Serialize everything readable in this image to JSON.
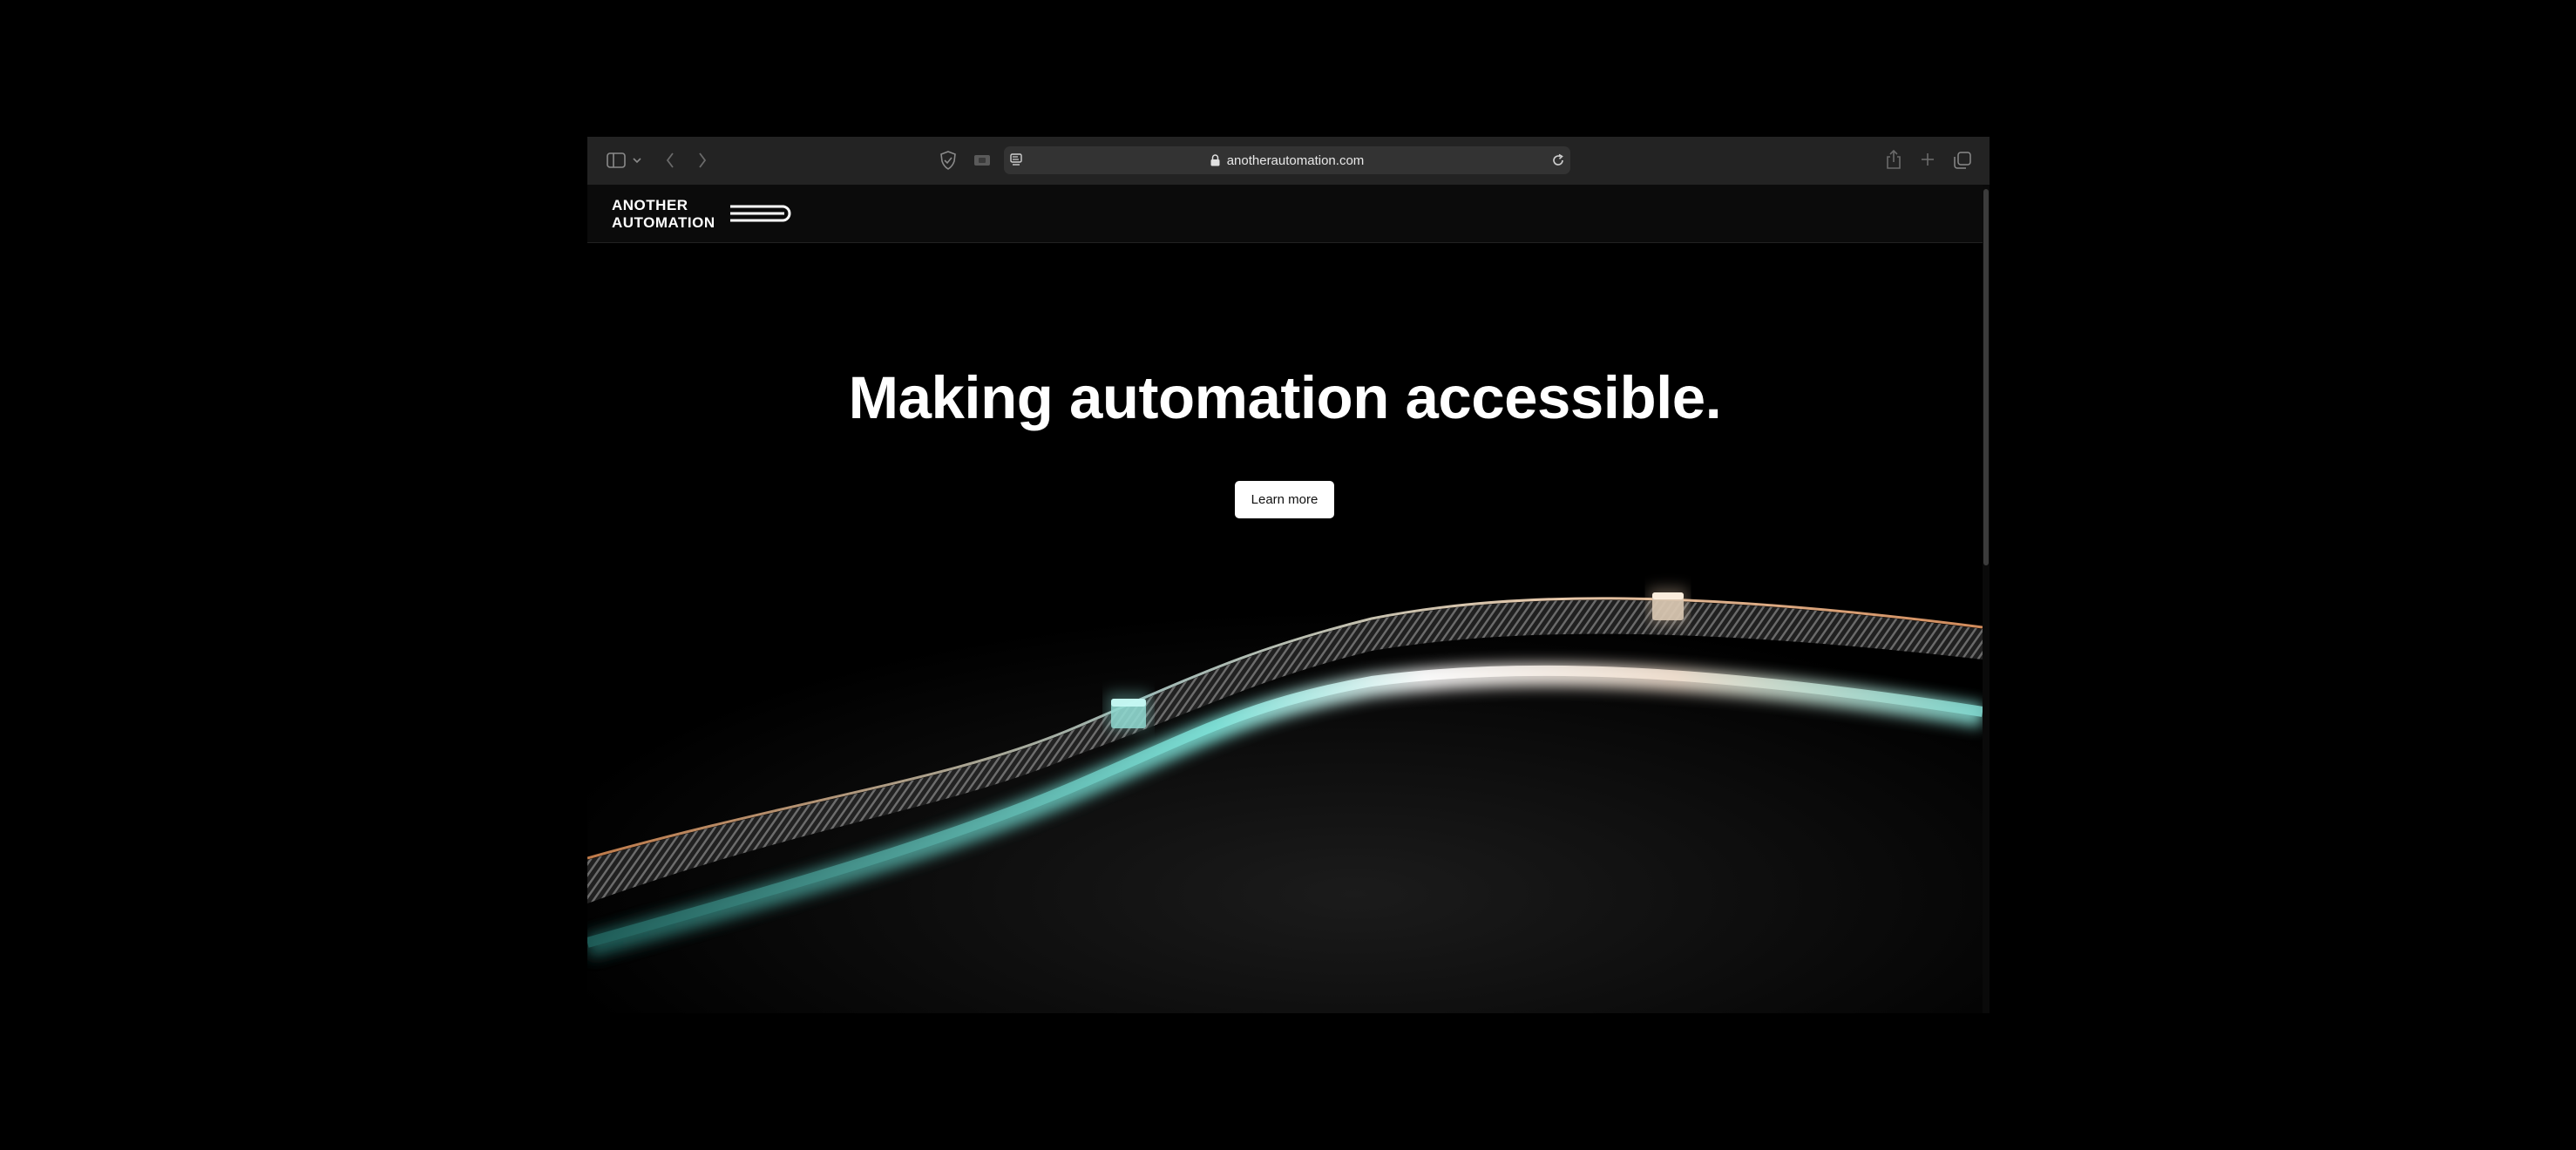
{
  "browser": {
    "url": "anotherautomation.com",
    "icons": [
      "sidebar-toggle-icon",
      "chevron-down-icon",
      "back-icon",
      "forward-icon",
      "privacy-shield-icon",
      "extension-icon",
      "reader-mode-icon",
      "lock-icon",
      "reload-icon",
      "share-icon",
      "new-tab-icon",
      "tab-overview-icon"
    ]
  },
  "site": {
    "logo_text_top": "ANOTHER",
    "logo_text_bottom": "AUTOMATION",
    "hero": {
      "title": "Making automation accessible.",
      "cta_label": "Learn more"
    }
  },
  "colors": {
    "page_background": "#000000",
    "toolbar": "#232323",
    "addressbar": "#333333",
    "conveyor_teal": "#5fd6cf",
    "conveyor_copper": "#d08a5a",
    "conveyor_white": "#ffffff"
  }
}
